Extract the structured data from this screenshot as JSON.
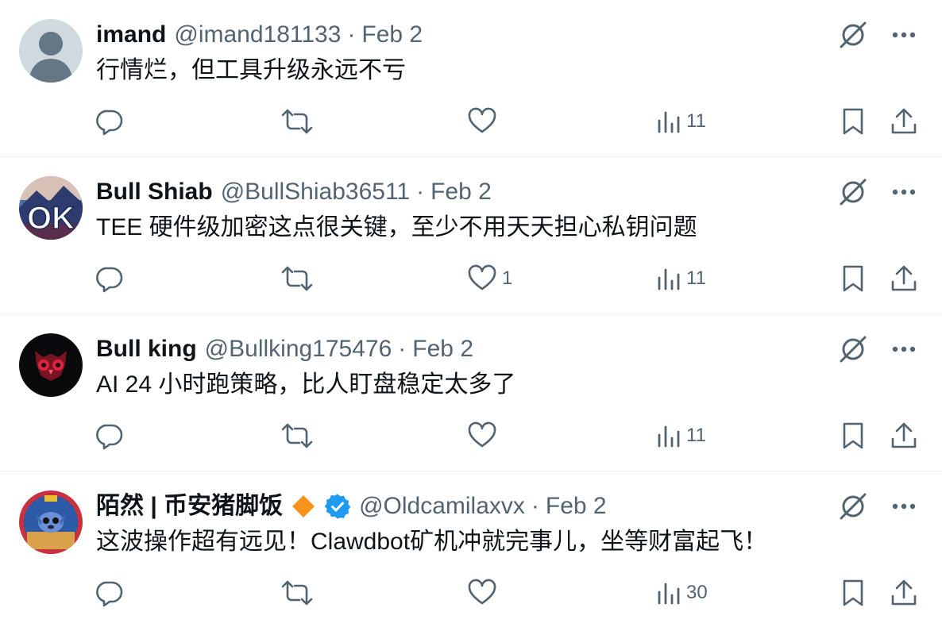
{
  "tweets": [
    {
      "display_name": "imand",
      "handle": "@imand181133",
      "separator": "·",
      "date": "Feb 2",
      "text": "行情烂，但工具升级永远不亏",
      "likes": "",
      "views": "11",
      "avatar_icon": "default-person-avatar"
    },
    {
      "display_name": "Bull Shiab",
      "handle": "@BullShiab36511",
      "separator": "·",
      "date": "Feb 2",
      "text": "TEE 硬件级加密这点很关键，至少不用天天担心私钥问题",
      "likes": "1",
      "views": "11",
      "avatar_icon": "ok-mountain-avatar"
    },
    {
      "display_name": "Bull king",
      "handle": "@Bullking175476",
      "separator": "·",
      "date": "Feb 2",
      "text": "AI 24 小时跑策略，比人盯盘稳定太多了",
      "likes": "",
      "views": "11",
      "avatar_icon": "red-owl-avatar"
    },
    {
      "display_name": "陌然 | 币安猪脚饭",
      "handle": "@Oldcamilaxvx",
      "separator": "·",
      "date": "Feb 2",
      "text": "这波操作超有远见！Clawdbot矿机冲就完事儿，坐等财富起飞！",
      "likes": "",
      "views": "30",
      "avatar_icon": "cartoon-character-avatar",
      "badges": [
        "orange-diamond-icon",
        "verified-badge-icon"
      ]
    }
  ],
  "colors": {
    "text_primary": "#0f1419",
    "text_secondary": "#536471",
    "divider": "#eff3f4",
    "verified": "#1d9bf0",
    "diamond": "#f7931a"
  }
}
